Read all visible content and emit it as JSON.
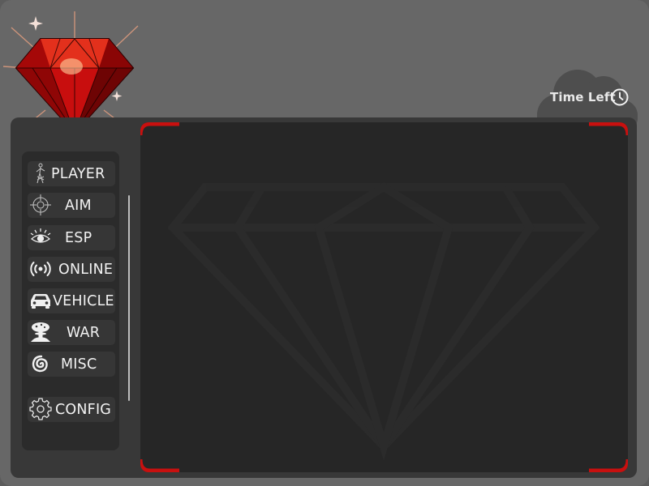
{
  "timer": {
    "label": "Time Left",
    "icon": "clock-icon"
  },
  "logo": {
    "icon": "red-diamond-logo",
    "color": "#d10f0f"
  },
  "theme": {
    "accent": "#c8100f",
    "window_bg": "#676767",
    "panel_bg": "#383838",
    "content_bg": "#262626",
    "sidebar_bg": "#2b2b2b",
    "item_bg": "#363636",
    "text": "#f2f2f2"
  },
  "sidebar": {
    "items": [
      {
        "label": "PLAYER",
        "icon": "player-icon"
      },
      {
        "label": "AIM",
        "icon": "crosshair-icon"
      },
      {
        "label": "ESP",
        "icon": "eye-icon"
      },
      {
        "label": "ONLINE",
        "icon": "broadcast-icon"
      },
      {
        "label": "VEHICLE",
        "icon": "car-icon"
      },
      {
        "label": "WAR",
        "icon": "mushroom-cloud-icon"
      },
      {
        "label": "MISC",
        "icon": "spiral-icon"
      },
      {
        "label": "CONFIG",
        "icon": "gear-icon"
      }
    ]
  }
}
